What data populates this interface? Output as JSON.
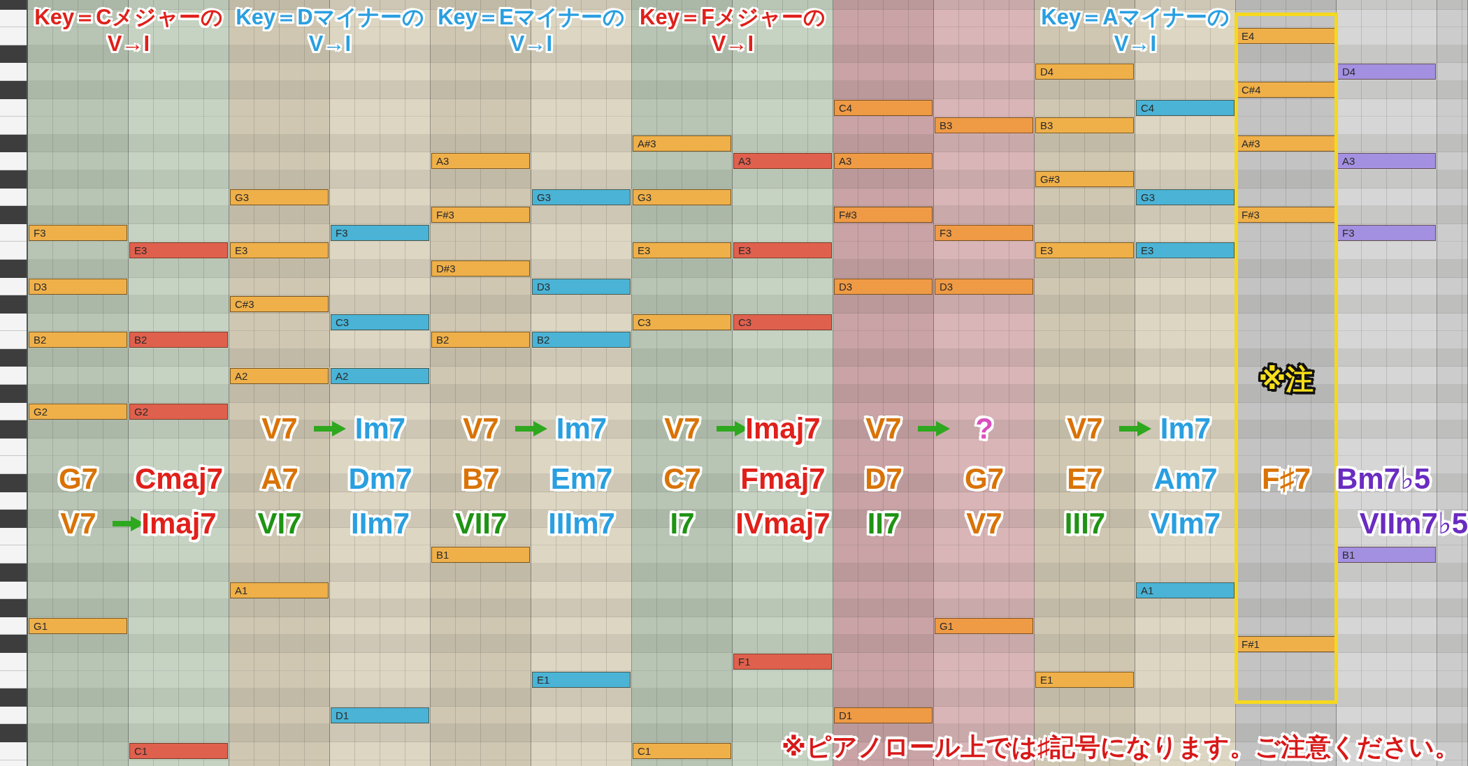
{
  "piano_roll": {
    "sections": [
      {
        "heading": {
          "text": "Key＝Cメジャーの",
          "subtext": "V→I",
          "color": "#e0201a"
        },
        "progression": {
          "kind": "below",
          "from": {
            "text": "V7",
            "color": "#d97306"
          },
          "to": {
            "text": "Imaj7",
            "color": "#e0201a"
          }
        },
        "columns": [
          {
            "chord": {
              "text": "G7",
              "color": "#d97306"
            },
            "color": "#efb04a",
            "highlighted": false,
            "notes": [
              "F3",
              "D3",
              "B2",
              "G2",
              "G1"
            ]
          },
          {
            "chord": {
              "text": "Cmaj7",
              "color": "#e0201a"
            },
            "color": "#e0604e",
            "highlighted": false,
            "notes": [
              "E3",
              "B2",
              "G2",
              "C1"
            ]
          }
        ]
      },
      {
        "heading": {
          "text": "Key＝Dマイナーの",
          "subtext": "V→I",
          "color": "#2a9fe0"
        },
        "progression": {
          "kind": "above",
          "from": {
            "text": "V7",
            "color": "#d97306"
          },
          "to": {
            "text": "Im7",
            "color": "#2a9fe0"
          }
        },
        "columns": [
          {
            "chord": {
              "text": "A7",
              "color": "#d97306"
            },
            "degree": {
              "text": "VI7",
              "color": "#1f9314"
            },
            "color": "#efb04a",
            "highlighted": false,
            "notes": [
              "G3",
              "E3",
              "C#3",
              "A2",
              "A1"
            ]
          },
          {
            "chord": {
              "text": "Dm7",
              "color": "#2a9fe0"
            },
            "degree": {
              "text": "IIm7",
              "color": "#2a9fe0"
            },
            "color": "#4ab3d6",
            "highlighted": false,
            "notes": [
              "F3",
              "C3",
              "A2",
              "D1"
            ]
          }
        ]
      },
      {
        "heading": {
          "text": "Key＝Eマイナーの",
          "subtext": "V→I",
          "color": "#2a9fe0"
        },
        "progression": {
          "kind": "above",
          "from": {
            "text": "V7",
            "color": "#d97306"
          },
          "to": {
            "text": "Im7",
            "color": "#2a9fe0"
          }
        },
        "columns": [
          {
            "chord": {
              "text": "B7",
              "color": "#d97306"
            },
            "degree": {
              "text": "VII7",
              "color": "#1f9314"
            },
            "color": "#efb04a",
            "highlighted": false,
            "notes": [
              "A3",
              "F#3",
              "D#3",
              "B2",
              "B1"
            ]
          },
          {
            "chord": {
              "text": "Em7",
              "color": "#2a9fe0"
            },
            "degree": {
              "text": "IIIm7",
              "color": "#2a9fe0"
            },
            "color": "#4ab3d6",
            "highlighted": false,
            "notes": [
              "G3",
              "D3",
              "B2",
              "E1"
            ]
          }
        ]
      },
      {
        "heading": {
          "text": "Key＝Fメジャーの",
          "subtext": "V→I",
          "color": "#e0201a"
        },
        "progression": {
          "kind": "above",
          "from": {
            "text": "V7",
            "color": "#d97306"
          },
          "to": {
            "text": "Imaj7",
            "color": "#e0201a"
          }
        },
        "columns": [
          {
            "chord": {
              "text": "C7",
              "color": "#d97306"
            },
            "degree": {
              "text": "I7",
              "color": "#1f9314"
            },
            "color": "#efb04a",
            "highlighted": false,
            "notes": [
              "A#3",
              "G3",
              "E3",
              "C3",
              "C1"
            ]
          },
          {
            "chord": {
              "text": "Fmaj7",
              "color": "#e0201a"
            },
            "degree": {
              "text": "IVmaj7",
              "color": "#e0201a"
            },
            "color": "#e0604e",
            "highlighted": false,
            "notes": [
              "A3",
              "E3",
              "C3",
              "F1"
            ]
          }
        ]
      },
      {
        "progression": {
          "kind": "above",
          "from": {
            "text": "V7",
            "color": "#d97306"
          },
          "to": {
            "text": "?",
            "color": "#d94fbd"
          }
        },
        "columns": [
          {
            "chord": {
              "text": "D7",
              "color": "#d97306"
            },
            "degree": {
              "text": "II7",
              "color": "#1f9314"
            },
            "color": "#ef9a45",
            "highlighted": false,
            "notes": [
              "C4",
              "A3",
              "F#3",
              "D3",
              "D1"
            ]
          },
          {
            "chord": {
              "text": "G7",
              "color": "#d97306"
            },
            "degree": {
              "text": "V7",
              "color": "#d97306"
            },
            "color": "#ef9a45",
            "highlighted": false,
            "notes": [
              "B3",
              "F3",
              "D3",
              "G1"
            ]
          }
        ]
      },
      {
        "heading": {
          "text": "Key＝Aマイナーの",
          "subtext": "V→I",
          "color": "#2a9fe0"
        },
        "progression": {
          "kind": "above",
          "from": {
            "text": "V7",
            "color": "#d97306"
          },
          "to": {
            "text": "Im7",
            "color": "#2a9fe0"
          }
        },
        "columns": [
          {
            "chord": {
              "text": "E7",
              "color": "#d97306"
            },
            "degree": {
              "text": "III7",
              "color": "#1f9314"
            },
            "color": "#efb04a",
            "highlighted": false,
            "notes": [
              "D4",
              "B3",
              "G#3",
              "E3",
              "E1"
            ]
          },
          {
            "chord": {
              "text": "Am7",
              "color": "#2a9fe0"
            },
            "degree": {
              "text": "VIm7",
              "color": "#2a9fe0"
            },
            "color": "#4ab3d6",
            "highlighted": false,
            "notes": [
              "C4",
              "G3",
              "E3",
              "A1"
            ]
          }
        ]
      },
      {
        "columns": [
          {
            "chord": {
              "text": "F♯7",
              "color": "#d97306"
            },
            "callout": "※注",
            "color": "#efb04a",
            "highlighted": true,
            "notes": [
              "E4",
              "C#4",
              "A#3",
              "F#3",
              "F#1"
            ]
          },
          {
            "chord": {
              "text": "Bm7♭5",
              "color": "#6a2cc0"
            },
            "degree": {
              "text": "VIIm7♭5",
              "color": "#6a2cc0"
            },
            "color": "#a390e0",
            "highlighted": false,
            "notes": [
              "D4",
              "A3",
              "F3",
              "B1"
            ]
          }
        ]
      }
    ],
    "footnote": "※ピアノロール上では♯記号になります。ご注意ください。"
  }
}
